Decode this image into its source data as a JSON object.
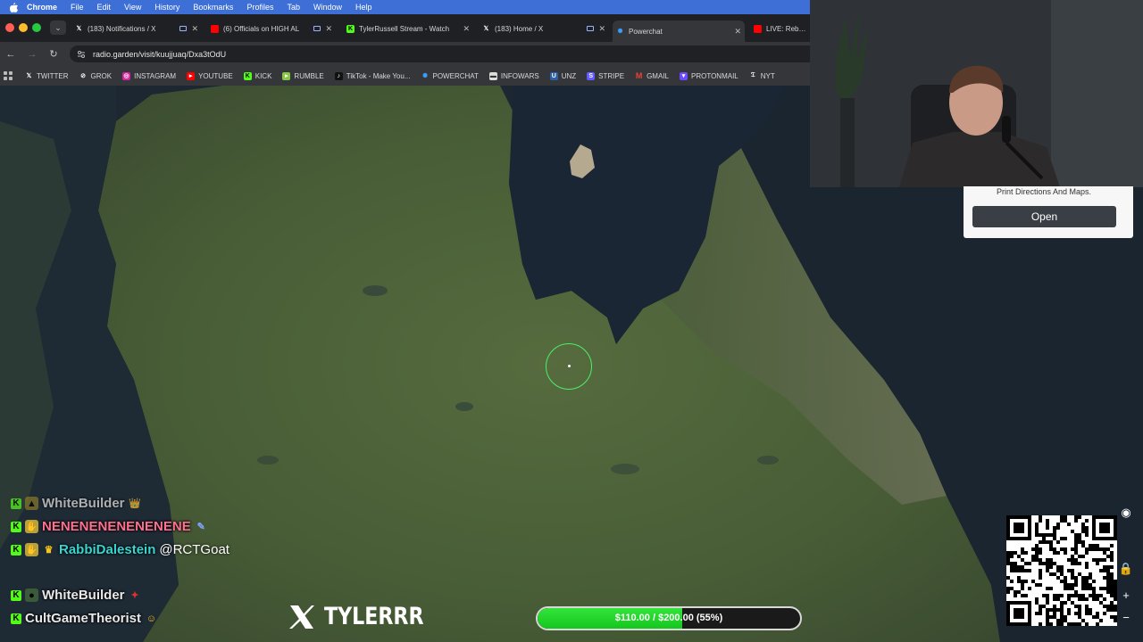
{
  "menubar": {
    "app": "Chrome",
    "items": [
      "File",
      "Edit",
      "View",
      "History",
      "Bookmarks",
      "Profiles",
      "Tab",
      "Window",
      "Help"
    ]
  },
  "tabs": [
    {
      "title": "(183) Notifications / X",
      "icon": "x-icon"
    },
    {
      "title": "(6) Officials on HIGH AL",
      "icon": "youtube-icon"
    },
    {
      "title": "TylerRussell Stream - Watch",
      "icon": "kick-icon"
    },
    {
      "title": "(183) Home / X",
      "icon": "x-icon"
    },
    {
      "title": "Powerchat",
      "icon": "powerchat-icon"
    },
    {
      "title": "LIVE: Rebuild",
      "icon": "youtube-icon"
    }
  ],
  "toolbar": {
    "url": "radio.garden/visit/kuujjuaq/Dxa3tOdU"
  },
  "bookmarks": [
    {
      "label": "TWITTER",
      "icon": "x-icon",
      "color": "#000000"
    },
    {
      "label": "GROK",
      "icon": "grok-icon",
      "color": "#222222"
    },
    {
      "label": "INSTAGRAM",
      "icon": "instagram-icon",
      "color": "#d6249f"
    },
    {
      "label": "YOUTUBE",
      "icon": "youtube-icon",
      "color": "#ff0000"
    },
    {
      "label": "KICK",
      "icon": "kick-icon",
      "color": "#53fc18"
    },
    {
      "label": "RUMBLE",
      "icon": "rumble-icon",
      "color": "#85c742"
    },
    {
      "label": "TikTok - Make You...",
      "icon": "tiktok-icon",
      "color": "#111111"
    },
    {
      "label": "POWERCHAT",
      "icon": "powerchat-icon",
      "color": "#3aa0ff"
    },
    {
      "label": "INFOWARS",
      "icon": "infowars-icon",
      "color": "#dddddd"
    },
    {
      "label": "UNZ",
      "icon": "unz-icon",
      "color": "#2d5fa8"
    },
    {
      "label": "STRIPE",
      "icon": "stripe-icon",
      "color": "#635bff"
    },
    {
      "label": "GMAIL",
      "icon": "gmail-icon",
      "color": "#ea4335"
    },
    {
      "label": "PROTONMAIL",
      "icon": "protonmail-icon",
      "color": "#6d4aff"
    },
    {
      "label": "NYT",
      "icon": "nyt-icon",
      "color": "#333333"
    }
  ],
  "ad": {
    "text": "Print Directions And Maps.",
    "button": "Open"
  },
  "chat": [
    {
      "user": "WhiteBuilder",
      "color": "#e8e8e8",
      "message": ""
    },
    {
      "user": "NENENENENENENENE",
      "color": "#ff6f8f",
      "message": ""
    },
    {
      "user": "RabbiDalestein",
      "color": "#36d6d1",
      "message": "@RCTGoat"
    },
    {
      "user": "WhiteBuilder",
      "color": "#e8e8e8",
      "message": ""
    },
    {
      "user": "CultGameTheorist",
      "color": "#e8e8e8",
      "message": ""
    }
  ],
  "overlay": {
    "handle": "TYLERRR"
  },
  "goal": {
    "text": "$110.00 / $200.00 (55%)",
    "current": 110,
    "target": 200,
    "fraction": 0.55
  },
  "colors": {
    "accent_green": "#49f06a",
    "kick_green": "#53fc18"
  }
}
